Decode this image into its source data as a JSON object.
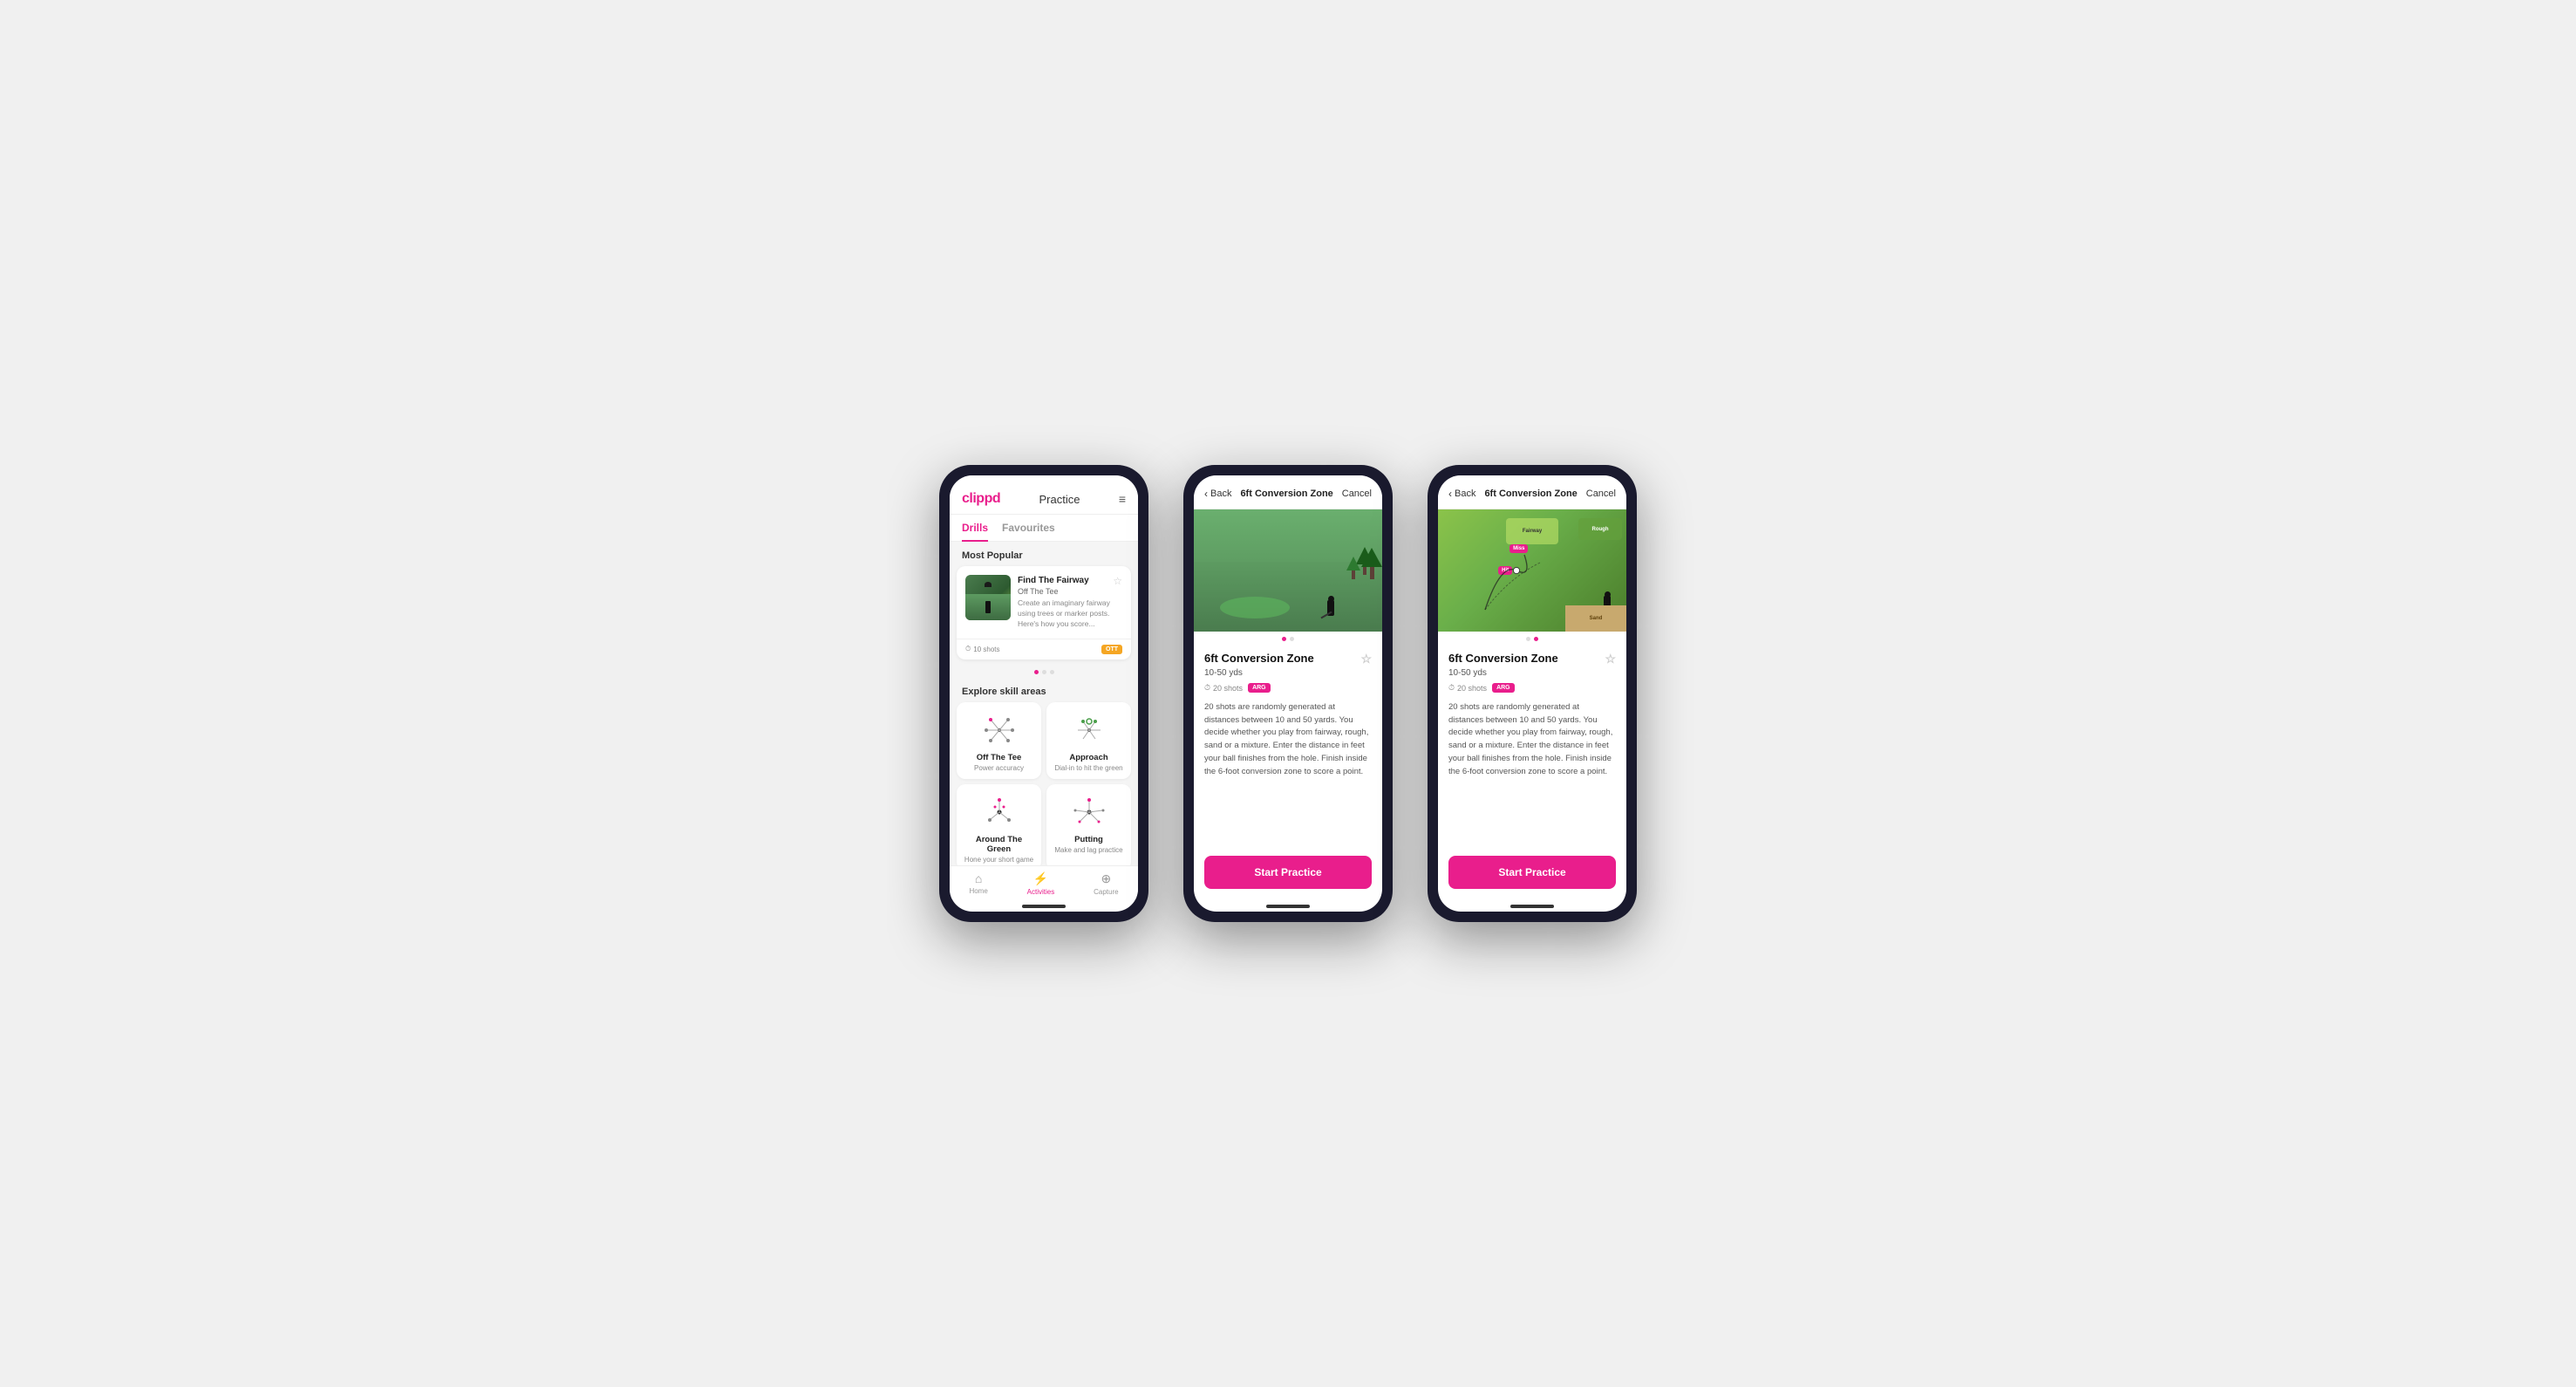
{
  "phone1": {
    "header": {
      "logo": "clippd",
      "title": "Practice",
      "menu_icon": "≡"
    },
    "tabs": [
      {
        "label": "Drills",
        "active": true
      },
      {
        "label": "Favourites",
        "active": false
      }
    ],
    "most_popular_label": "Most Popular",
    "featured_card": {
      "title": "Find The Fairway",
      "subtitle": "Off The Tee",
      "description": "Create an imaginary fairway using trees or marker posts. Here's how you score...",
      "shots": "10 shots",
      "tag": "OTT"
    },
    "explore_label": "Explore skill areas",
    "skills": [
      {
        "name": "Off The Tee",
        "desc": "Power accuracy"
      },
      {
        "name": "Approach",
        "desc": "Dial-in to hit the green"
      },
      {
        "name": "Around The Green",
        "desc": "Hone your short game"
      },
      {
        "name": "Putting",
        "desc": "Make and lag practice"
      }
    ],
    "nav": [
      {
        "label": "Home",
        "icon": "⌂",
        "active": false
      },
      {
        "label": "Activities",
        "icon": "⚡",
        "active": true
      },
      {
        "label": "Capture",
        "icon": "⊕",
        "active": false
      }
    ]
  },
  "phone2": {
    "header": {
      "back": "Back",
      "title": "6ft Conversion Zone",
      "cancel": "Cancel"
    },
    "drill": {
      "title": "6ft Conversion Zone",
      "range": "10-50 yds",
      "shots": "20 shots",
      "tag": "ARG",
      "description": "20 shots are randomly generated at distances between 10 and 50 yards. You decide whether you play from fairway, rough, sand or a mixture. Enter the distance in feet your ball finishes from the hole. Finish inside the 6-foot conversion zone to score a point.",
      "cta": "Start Practice",
      "image_type": "photo",
      "dots": [
        "active",
        "inactive"
      ]
    }
  },
  "phone3": {
    "header": {
      "back": "Back",
      "title": "6ft Conversion Zone",
      "cancel": "Cancel"
    },
    "drill": {
      "title": "6ft Conversion Zone",
      "range": "10-50 yds",
      "shots": "20 shots",
      "tag": "ARG",
      "description": "20 shots are randomly generated at distances between 10 and 50 yards. You decide whether you play from fairway, rough, sand or a mixture. Enter the distance in feet your ball finishes from the hole. Finish inside the 6-foot conversion zone to score a point.",
      "cta": "Start Practice",
      "image_type": "map",
      "map_labels": [
        "Fairway",
        "Rough",
        "Miss",
        "Hit",
        "Sand"
      ],
      "dots": [
        "inactive",
        "active"
      ]
    }
  }
}
